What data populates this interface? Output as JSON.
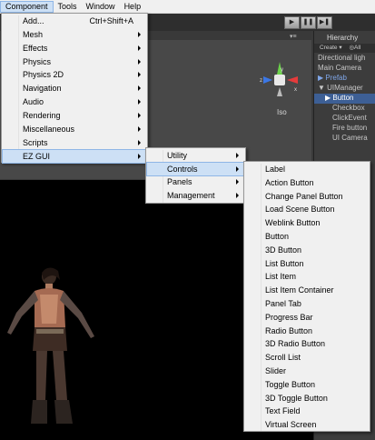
{
  "menubar": {
    "items": [
      "Component",
      "Tools",
      "Window",
      "Help"
    ],
    "active_index": 0
  },
  "play_controls": [
    "play",
    "pause",
    "step"
  ],
  "scene": {
    "gizmo_axes": [
      "y",
      "z",
      "x"
    ],
    "projection_label": "Iso"
  },
  "hierarchy": {
    "title": "Hierarchy",
    "create_label": "Create ▾",
    "search_label": "◎All",
    "rows": [
      {
        "label": "Directional ligh",
        "indent": 0,
        "style": "normal"
      },
      {
        "label": "Main Camera",
        "indent": 0,
        "style": "normal"
      },
      {
        "label": "▶ Prefab",
        "indent": 0,
        "style": "blue"
      },
      {
        "label": "▼ UIManager",
        "indent": 0,
        "style": "normal"
      },
      {
        "label": "▶ Button",
        "indent": 1,
        "style": "selected"
      },
      {
        "label": "Checkbox",
        "indent": 2,
        "style": "normal"
      },
      {
        "label": "ClickEvent",
        "indent": 2,
        "style": "normal"
      },
      {
        "label": "Fire button",
        "indent": 2,
        "style": "normal"
      },
      {
        "label": "UI Camera",
        "indent": 2,
        "style": "normal"
      }
    ]
  },
  "component_menu": {
    "items": [
      {
        "label": "Add...",
        "shortcut": "Ctrl+Shift+A",
        "submenu": false,
        "highlight": false
      },
      {
        "label": "Mesh",
        "submenu": true
      },
      {
        "label": "Effects",
        "submenu": true
      },
      {
        "label": "Physics",
        "submenu": true
      },
      {
        "label": "Physics 2D",
        "submenu": true
      },
      {
        "label": "Navigation",
        "submenu": true
      },
      {
        "label": "Audio",
        "submenu": true
      },
      {
        "label": "Rendering",
        "submenu": true
      },
      {
        "label": "Miscellaneous",
        "submenu": true
      },
      {
        "label": "Scripts",
        "submenu": true
      },
      {
        "label": "EZ GUI",
        "submenu": true,
        "highlight": true
      }
    ]
  },
  "ezgui_menu": {
    "items": [
      {
        "label": "Utility",
        "submenu": true
      },
      {
        "label": "Controls",
        "submenu": true,
        "highlight": true
      },
      {
        "label": "Panels",
        "submenu": true
      },
      {
        "label": "Management",
        "submenu": true
      }
    ]
  },
  "controls_menu": {
    "items": [
      "Label",
      "Action Button",
      "Change Panel Button",
      "Load Scene Button",
      "Weblink Button",
      "Button",
      "3D Button",
      "List Button",
      "List Item",
      "List Item Container",
      "Panel Tab",
      "Progress Bar",
      "Radio Button",
      "3D Radio Button",
      "Scroll List",
      "Slider",
      "Toggle Button",
      "3D Toggle Button",
      "Text Field",
      "Virtual Screen"
    ]
  },
  "colors": {
    "menu_bg": "#f0f0f0",
    "menu_highlight": "#cde0f5",
    "menu_highlight_border": "#8fb6e6",
    "editor_bg": "#3a3a3a",
    "game_view_bg": "#000000",
    "hierarchy_selected": "#3d5f95",
    "gizmo_x": "#e53b3b",
    "gizmo_y": "#6bd14a",
    "gizmo_z": "#3b77e5"
  }
}
